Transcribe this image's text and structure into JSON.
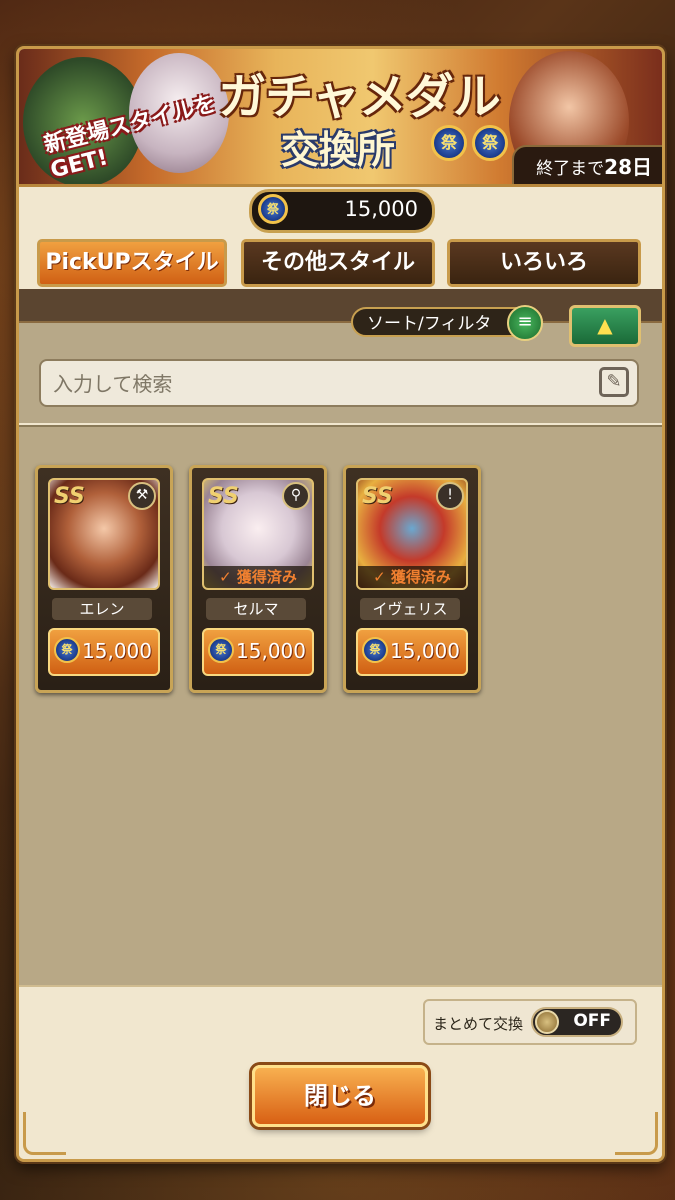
{
  "banner": {
    "title": "ガチャメダル",
    "subtitle": "交換所",
    "new_style": "新登場スタイルをGET!",
    "medal_glyph": "祭",
    "end_prefix": "終了まで",
    "end_days": "28日"
  },
  "medal_count": "15,000",
  "tabs": [
    {
      "label": "PickUPスタイル",
      "active": true
    },
    {
      "label": "その他スタイル",
      "active": false
    },
    {
      "label": "いろいろ",
      "active": false
    }
  ],
  "sort_filter_label": "ソート/フィルタ",
  "search": {
    "placeholder": "入力して検索"
  },
  "cards": [
    {
      "name": "エレン",
      "price": "15,000",
      "owned": "",
      "weapon_icon": "axe-icon",
      "rank": "SS"
    },
    {
      "name": "セルマ",
      "price": "15,000",
      "owned": "獲得済み",
      "weapon_icon": "staff-icon",
      "rank": "SS"
    },
    {
      "name": "イヴェリス",
      "price": "15,000",
      "owned": "獲得済み",
      "weapon_icon": "sword-icon",
      "rank": "SS"
    }
  ],
  "bulk_exchange": {
    "label": "まとめて交換",
    "state": "OFF"
  },
  "close_label": "閉じる",
  "colors": {
    "accent": "#d06014",
    "frame": "#c89a4a",
    "panel": "#f1e7cf"
  }
}
